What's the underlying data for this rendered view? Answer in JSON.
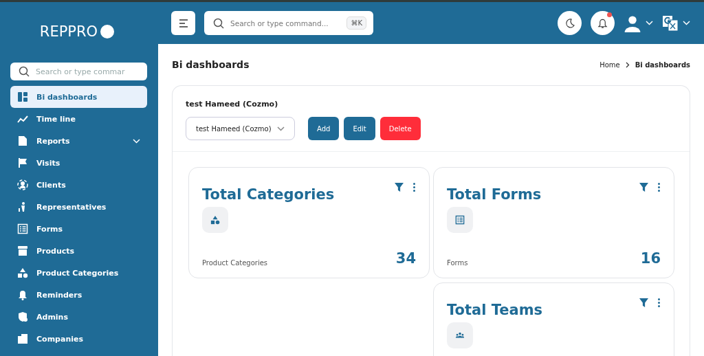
{
  "sidebar": {
    "logo": "REPPRO",
    "search": {
      "placeholder": "Search or type commar"
    },
    "items": [
      {
        "label": "Bi dashboards",
        "selected": true,
        "expandable": false
      },
      {
        "label": "Time line",
        "selected": false,
        "expandable": false
      },
      {
        "label": "Reports",
        "selected": false,
        "expandable": true
      },
      {
        "label": "Visits",
        "selected": false,
        "expandable": false
      },
      {
        "label": "Clients",
        "selected": false,
        "expandable": false
      },
      {
        "label": "Representatives",
        "selected": false,
        "expandable": false
      },
      {
        "label": "Forms",
        "selected": false,
        "expandable": false
      },
      {
        "label": "Products",
        "selected": false,
        "expandable": false
      },
      {
        "label": "Product Categories",
        "selected": false,
        "expandable": false
      },
      {
        "label": "Reminders",
        "selected": false,
        "expandable": false
      },
      {
        "label": "Admins",
        "selected": false,
        "expandable": false
      },
      {
        "label": "Companies",
        "selected": false,
        "expandable": false
      }
    ]
  },
  "header": {
    "search": {
      "placeholder": "Search or type command...",
      "shortcut": "⌘K"
    },
    "notification_dot": true
  },
  "page": {
    "title": "Bi dashboards",
    "breadcrumb": [
      "Home",
      "Bi dashboards"
    ]
  },
  "dashboard": {
    "name": "test Hameed (Cozmo)",
    "select_value": "test Hameed (Cozmo)",
    "buttons": [
      {
        "label": "Add",
        "kind": "primary"
      },
      {
        "label": "Edit",
        "kind": "primary"
      },
      {
        "label": "Delete",
        "kind": "danger"
      }
    ]
  },
  "cards": [
    {
      "title": "Total Categories",
      "caption": "Product Categories",
      "value": "34"
    },
    {
      "title": "Total Forms",
      "caption": "Forms",
      "value": "16"
    },
    {
      "title": "Total Teams"
    }
  ]
}
